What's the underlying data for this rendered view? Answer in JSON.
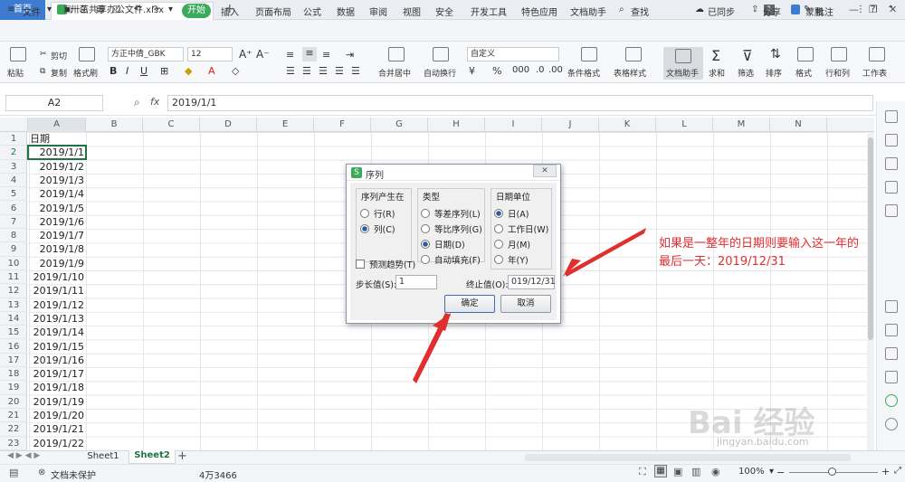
{
  "titlebar": {
    "home": "首页",
    "file": "卅茁共享办公文件.xlsx",
    "new_tab": "+",
    "badge": "1",
    "user": "蒙鹏"
  },
  "menubar": {
    "file": "文件",
    "start": "开始",
    "items": [
      "插入",
      "页面布局",
      "公式",
      "数据",
      "审阅",
      "视图",
      "安全",
      "开发工具",
      "特色应用",
      "文档助手"
    ],
    "search": "查找",
    "sync": "已同步",
    "share": "分享",
    "annotate": "批注"
  },
  "ribbon": {
    "paste": "粘贴",
    "cut": "剪切",
    "copy": "复制",
    "format_painter": "格式刷",
    "font_name": "方正中倩_GBK",
    "font_size": "12",
    "merge": "合并居中",
    "wrap": "自动换行",
    "number_format": "自定义",
    "percent": "%",
    "cond_format": "条件格式",
    "table_style": "表格样式",
    "doc_assist": "文档助手",
    "sum": "求和",
    "filter": "筛选",
    "sort": "排序",
    "format": "格式",
    "rowcol": "行和列",
    "worksheet": "工作表"
  },
  "formula": {
    "cell_ref": "A2",
    "fx": "fx",
    "value": "2019/1/1"
  },
  "columns": [
    "A",
    "B",
    "C",
    "D",
    "E",
    "F",
    "G",
    "H",
    "I",
    "J",
    "K",
    "L",
    "M",
    "N"
  ],
  "rows": [
    "1",
    "2",
    "3",
    "4",
    "5",
    "6",
    "7",
    "8",
    "9",
    "10",
    "11",
    "12",
    "13",
    "14",
    "15",
    "16",
    "17",
    "18",
    "19",
    "20",
    "21",
    "22",
    "23"
  ],
  "cells": [
    "日期",
    "2019/1/1",
    "2019/1/2",
    "2019/1/3",
    "2019/1/4",
    "2019/1/5",
    "2019/1/6",
    "2019/1/7",
    "2019/1/8",
    "2019/1/9",
    "2019/1/10",
    "2019/1/11",
    "2019/1/12",
    "2019/1/13",
    "2019/1/14",
    "2019/1/15",
    "2019/1/16",
    "2019/1/17",
    "2019/1/18",
    "2019/1/19",
    "2019/1/20",
    "2019/1/21",
    "2019/1/22"
  ],
  "sheets": {
    "s1": "Sheet1",
    "s2": "Sheet2",
    "add": "+"
  },
  "status": {
    "protect": "文档未保护",
    "count": "4万3466",
    "zoom": "100%"
  },
  "dialog": {
    "title": "序列",
    "series_in": {
      "label": "序列产生在",
      "options": [
        "行(R)",
        "列(C)"
      ]
    },
    "type": {
      "label": "类型",
      "options": [
        "等差序列(L)",
        "等比序列(G)",
        "日期(D)",
        "自动填充(F)"
      ]
    },
    "date_unit": {
      "label": "日期单位",
      "options": [
        "日(A)",
        "工作日(W)",
        "月(M)",
        "年(Y)"
      ]
    },
    "trend": "预测趋势(T)",
    "step_label": "步长值(S):",
    "step_value": "1",
    "stop_label": "终止值(O):",
    "stop_value": "019/12/31",
    "ok": "确定",
    "cancel": "取消"
  },
  "annotation": {
    "line1": "如果是一整年的日期则要输入这一年的",
    "line2": "最后一天：2019/12/31"
  },
  "watermark": {
    "logo": "Bai 经验",
    "url": "jingyan.baidu.com"
  }
}
